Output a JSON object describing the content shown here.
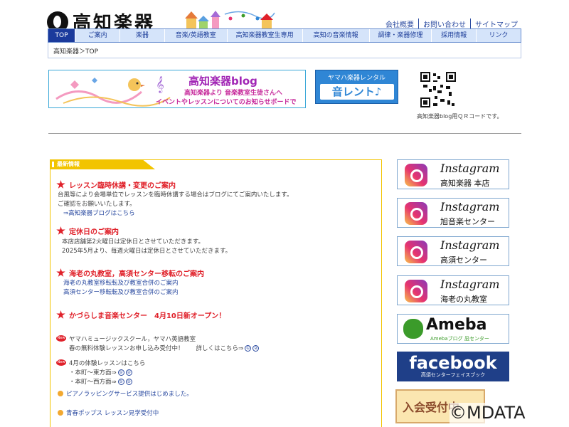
{
  "header": {
    "logo_text": "高知楽器",
    "utility_links": [
      "会社概要",
      "お問い合わせ",
      "サイトマップ"
    ]
  },
  "nav": {
    "items": [
      "TOP",
      "ご案内",
      "楽器",
      "音楽/英語教室",
      "高知楽器教室生専用",
      "高知の音楽情報",
      "調律・楽器修理",
      "採用情報",
      "リンク"
    ]
  },
  "breadcrumb": "高知楽器＞TOP",
  "blog_banner": {
    "title": "高知楽器blog",
    "line1": "高知楽器より 音楽教室生徒さんへ",
    "line2": "イベントやレッスンについてのお知らせボードです。"
  },
  "rental_banner": {
    "line1": "ヤマハ楽器レンタル",
    "line2": "音レント♪"
  },
  "qr": {
    "caption": "高知楽器blog用ＱＲコードです。"
  },
  "news": {
    "tab": "最新情報",
    "items": [
      {
        "title": "レッスン臨時休講・変更のご案内",
        "lines": [
          "台風等により会場単位でレッスンを臨時休講する場合はブログにてご案内いたします。",
          "ご確認をお願いいたします。",
          "⇒高知楽器ブログはこちら"
        ]
      },
      {
        "title": "定休日のご案内",
        "lines": [
          "本店店舗第2火曜日は定休日とさせていただきます。",
          "2025年5月より、毎週火曜日は定休日とさせていただきます。"
        ]
      },
      {
        "title": "海老の丸教室，高須センター移転のご案内",
        "lines": [
          "海老の丸教室移転転及び教室合併のご案内",
          "高須センター移転転及び教室合併のご案内"
        ]
      },
      {
        "title": "かづらしま音楽センター　4月10日新オープン！",
        "lines": []
      }
    ],
    "new_icon": "New",
    "news2": {
      "lines": [
        "ヤマハミュージックスクール，ヤマハ英語教室",
        "春の無料体験レッスンお申し込み受付中！　　詳しくはこちら⇒"
      ],
      "links": [
        "①",
        "②"
      ]
    },
    "news3": {
      "lines": [
        "4月の体験レッスンはこちら",
        "・本町～東方面⇒",
        "・本町～西方面⇒"
      ],
      "links": [
        "①",
        "②"
      ]
    },
    "bullets": [
      "ピアノラッピングサービス提供はじめました。",
      "青春ポップス レッスン見学受付中"
    ]
  },
  "social": {
    "instagram_word": "Instagram",
    "instagram": [
      "高知楽器 本店",
      "旭音楽センター",
      "高須センター",
      "海老の丸教室"
    ],
    "ameba": {
      "word": "Ameba",
      "sub": "Amebaブログ 凪センター"
    },
    "facebook": {
      "word": "facebook",
      "sub": "高須センターフェイスブック"
    },
    "recruit": "入会受付中"
  },
  "watermark": "©MDATA",
  "colors": {
    "nav_active": "#1b3a9c",
    "news_accent": "#f2c400",
    "headline_red": "#e0212a",
    "link_blue": "#2a4aa0"
  }
}
